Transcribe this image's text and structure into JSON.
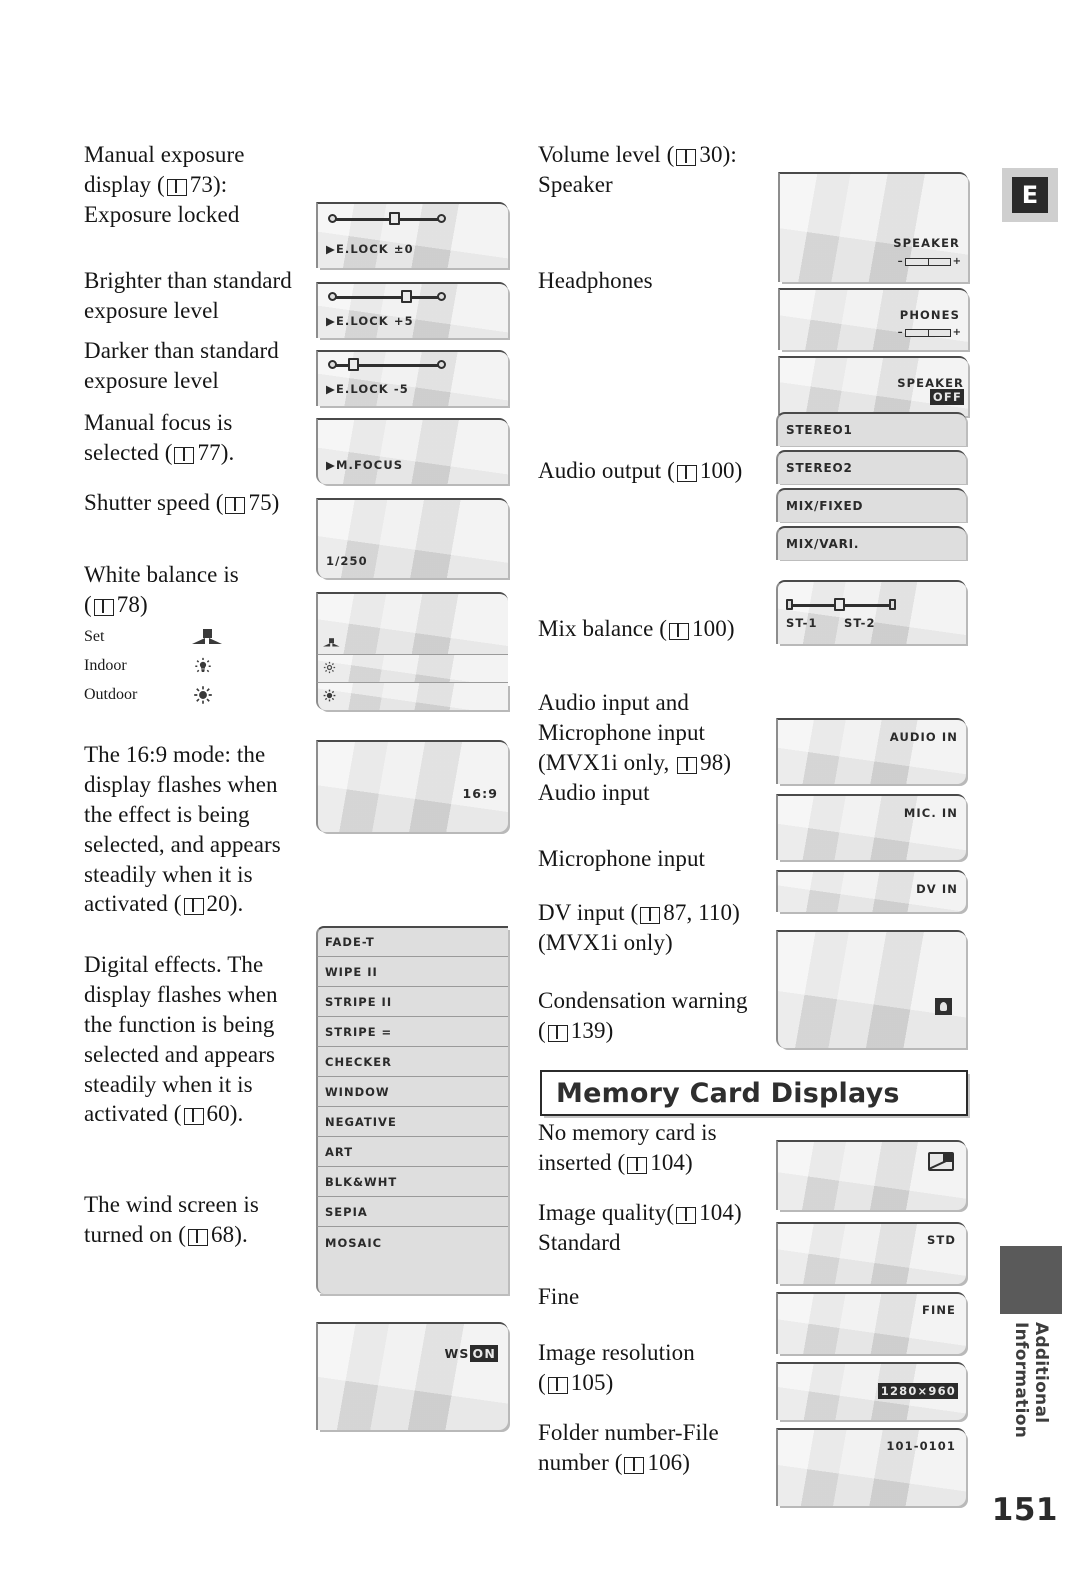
{
  "page": {
    "number": "151",
    "language_tab": "E",
    "side_label": "Additional\nInformation"
  },
  "left_column": [
    {
      "caption_lines": [
        "Manual exposure",
        "display ( 73):",
        "Exposure locked"
      ],
      "ref_pages": [
        "73"
      ],
      "screen": {
        "type": "exposure",
        "osd": "E.LOCK ±0",
        "knob_pos": 0.5
      }
    },
    {
      "caption_lines": [
        "Brighter than standard",
        "exposure level"
      ],
      "screen": {
        "type": "exposure",
        "osd": "E.LOCK  +5",
        "knob_pos": 0.62
      }
    },
    {
      "caption_lines": [
        "Darker than standard",
        "exposure level"
      ],
      "screen": {
        "type": "exposure",
        "osd": "E.LOCK  -5",
        "knob_pos": 0.17
      }
    },
    {
      "caption_lines": [
        "Manual focus is",
        "selected ( 77)."
      ],
      "ref_pages": [
        "77"
      ],
      "screen": {
        "type": "plain",
        "osd": "M.FOCUS",
        "osd_pos": "bottom-left"
      }
    },
    {
      "caption_lines": [
        "Shutter speed ( 75)"
      ],
      "ref_pages": [
        "75"
      ],
      "screen": {
        "type": "plain",
        "osd": "1/250",
        "osd_pos": "bottom-left"
      }
    },
    {
      "caption_lines": [
        "White balance is",
        "( 78)",
        "Set",
        "Indoor",
        "Outdoor"
      ],
      "ref_pages": [
        "78"
      ],
      "wb_labels": [
        "Set",
        "Indoor",
        "Outdoor"
      ],
      "wb_icons": [
        "wb-set-icon",
        "wb-indoor-bulb-icon",
        "wb-outdoor-sun-icon"
      ],
      "screen": {
        "type": "whitebalance",
        "rows": 3
      }
    },
    {
      "caption_lines": [
        "The 16:9 mode: the",
        "display flashes when",
        "the effect is being",
        "selected, and appears",
        "steadily when it is",
        "activated ( 20)."
      ],
      "ref_pages": [
        "20"
      ],
      "screen": {
        "type": "plain",
        "osd": "16:9",
        "osd_pos": "bottom-right"
      }
    },
    {
      "caption_lines": [
        "Digital effects. The",
        "display flashes when",
        "the function is being",
        "selected and appears",
        "steadily when it is",
        "activated ( 60)."
      ],
      "ref_pages": [
        "60"
      ],
      "screen": {
        "type": "effect-list",
        "items": [
          "FADE-T",
          "WIPE II",
          "STRIPE II",
          "STRIPE =",
          "CHECKER",
          "WINDOW",
          "NEGATIVE",
          "ART",
          "BLK&WHT",
          "SEPIA",
          "MOSAIC"
        ]
      }
    },
    {
      "caption_lines": [
        "The wind screen is",
        "turned on ( 68)."
      ],
      "ref_pages": [
        "68"
      ],
      "screen": {
        "type": "plain",
        "osd": "WS",
        "osd_badge": "ON",
        "osd_pos": "top-right"
      }
    }
  ],
  "right_column": [
    {
      "caption_lines": [
        "Volume level ( 30):",
        "Speaker"
      ],
      "ref_pages": [
        "30"
      ],
      "screen": {
        "type": "volume",
        "osd": "SPEAKER",
        "has_bar": true
      }
    },
    {
      "caption_lines": [
        "Headphones"
      ],
      "screen": {
        "type": "volume",
        "osd": "PHONES",
        "has_bar": true
      }
    },
    {
      "caption_lines": [],
      "screen": {
        "type": "volume-off",
        "osd": "SPEAKER",
        "osd_badge": "OFF"
      }
    },
    {
      "caption_lines": [
        "Audio output ( 100)"
      ],
      "ref_pages": [
        "100"
      ],
      "screen": {
        "type": "option-list",
        "items": [
          "STEREO1",
          "STEREO2",
          "MIX/FIXED",
          "MIX/VARI."
        ]
      }
    },
    {
      "caption_lines": [
        "Mix balance ( 100)"
      ],
      "ref_pages": [
        "100"
      ],
      "screen": {
        "type": "mixbalance",
        "left_label": "ST-1",
        "right_label": "ST-2",
        "knob_pos": 0.45
      }
    },
    {
      "caption_lines": [
        "Audio input and",
        "Microphone input",
        "(MVX1i only,  98)",
        "Audio input"
      ],
      "ref_pages": [
        "98"
      ],
      "screen": {
        "type": "plain",
        "osd": "AUDIO IN",
        "osd_pos": "top-right"
      }
    },
    {
      "caption_lines": [
        "Microphone input"
      ],
      "screen": {
        "type": "plain",
        "osd": "MIC. IN",
        "osd_pos": "top-right"
      }
    },
    {
      "caption_lines": [
        "DV input ( 87, 110)",
        "(MVX1i only)"
      ],
      "ref_pages": [
        "87, 110"
      ],
      "screen": {
        "type": "plain",
        "osd": "DV IN",
        "osd_pos": "top-right"
      }
    },
    {
      "caption_lines": [
        "Condensation warning",
        "( 139)"
      ],
      "ref_pages": [
        "139"
      ],
      "screen": {
        "type": "condensation",
        "icon": "condensation-warning-icon"
      }
    }
  ],
  "memory_section": {
    "heading": "Memory Card Displays",
    "rows": [
      {
        "caption_lines": [
          "No memory card is",
          "inserted ( 104)"
        ],
        "ref_pages": [
          "104"
        ],
        "screen": {
          "type": "no-card",
          "icon": "no-memory-card-icon"
        }
      },
      {
        "caption_lines": [
          "Image quality( 104)",
          "Standard"
        ],
        "ref_pages": [
          "104"
        ],
        "screen": {
          "type": "plain",
          "osd": "STD",
          "osd_pos": "top-right"
        }
      },
      {
        "caption_lines": [
          "Fine"
        ],
        "screen": {
          "type": "plain",
          "osd": "FINE",
          "osd_pos": "top-right"
        }
      },
      {
        "caption_lines": [
          "Image resolution",
          "( 105)"
        ],
        "ref_pages": [
          "105"
        ],
        "screen": {
          "type": "plain",
          "osd": "1280×960",
          "osd_inverted": true,
          "osd_pos": "mid-right"
        }
      },
      {
        "caption_lines": [
          "Folder number-File",
          "number ( 106)"
        ],
        "ref_pages": [
          "106"
        ],
        "screen": {
          "type": "plain",
          "osd": "101-0101",
          "osd_pos": "top-right"
        }
      }
    ]
  }
}
